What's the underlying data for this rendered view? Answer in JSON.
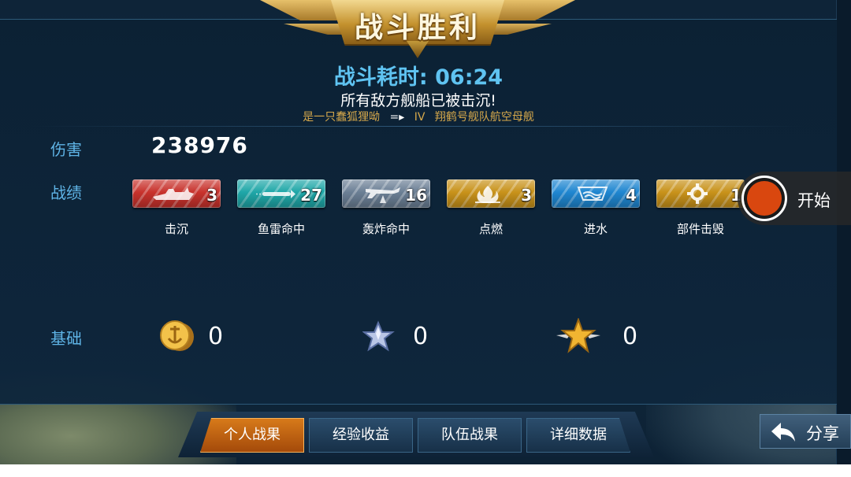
{
  "header": {
    "title": "战斗胜利"
  },
  "summary": {
    "duration_label": "战斗耗时: 06:24",
    "result_text": "所有敌方舰船已被击沉!",
    "player_name": "是一只蠢狐狸呦",
    "arrow_glyph": "=▸",
    "ship_tier": "IV",
    "ship_name": "翔鹤号舰队航空母舰"
  },
  "damage": {
    "label": "伤害",
    "value": "238976"
  },
  "records": {
    "label": "战绩",
    "medals": [
      {
        "name": "击沉",
        "count": "3",
        "color": "#c8322c",
        "icon": "ship-silhouette-icon"
      },
      {
        "name": "鱼雷命中",
        "count": "27",
        "color": "#1fa7a8",
        "icon": "torpedo-icon"
      },
      {
        "name": "轰炸命中",
        "count": "16",
        "color": "#6b7f95",
        "icon": "bomber-icon"
      },
      {
        "name": "点燃",
        "count": "3",
        "color": "#c8921a",
        "icon": "fire-icon"
      },
      {
        "name": "进水",
        "count": "4",
        "color": "#1f86d0",
        "icon": "flooding-icon"
      },
      {
        "name": "部件击毁",
        "count": "1",
        "color": "#c8921a",
        "icon": "gear-icon"
      }
    ]
  },
  "base": {
    "label": "基础",
    "items": [
      {
        "icon": "gold-coin-icon",
        "value": "0"
      },
      {
        "icon": "silver-star-icon",
        "value": "0"
      },
      {
        "icon": "gold-winged-star-icon",
        "value": "0"
      }
    ]
  },
  "recorder": {
    "label": "开始",
    "color": "#d9470f"
  },
  "tabs": [
    {
      "label": "个人战果",
      "active": true
    },
    {
      "label": "经验收益",
      "active": false
    },
    {
      "label": "队伍战果",
      "active": false
    },
    {
      "label": "详细数据",
      "active": false
    }
  ],
  "share": {
    "label": "分享"
  },
  "colors": {
    "accent_blue": "#5fb4e6",
    "gold": "#d6a84b",
    "tab_active": "#d77a1a"
  }
}
